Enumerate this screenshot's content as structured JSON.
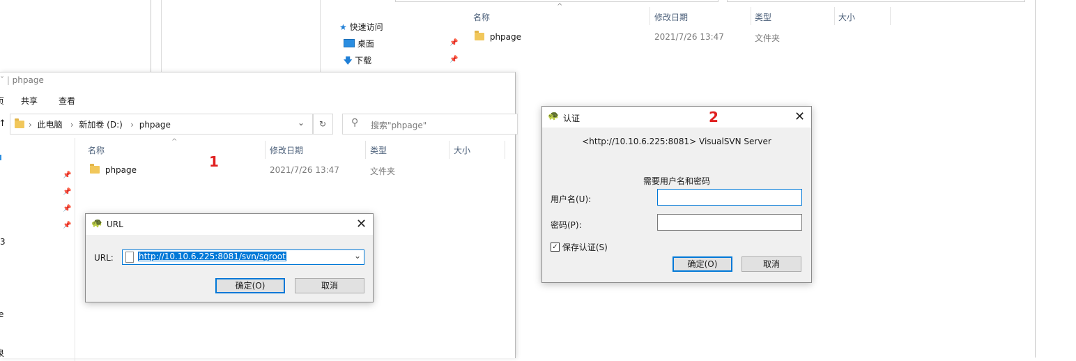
{
  "bg_window": {
    "nav_quick_access": "快速访问",
    "nav_desktop": "桌面",
    "nav_downloads": "下载",
    "columns": [
      "名称",
      "修改日期",
      "类型",
      "大小"
    ],
    "row": {
      "name": "phpage",
      "date": "2021/7/26 13:47",
      "type": "文件夹"
    }
  },
  "fg_window": {
    "title": "phpage",
    "ribbon_partial": "页",
    "ribbon_share": "共享",
    "ribbon_view": "查看",
    "breadcrumb": [
      "此电脑",
      "新加卷 (D:)",
      "phpage"
    ],
    "search_placeholder": "搜索\"phpage\"",
    "columns": [
      "名称",
      "修改日期",
      "类型",
      "大小"
    ],
    "row": {
      "name": "phpage",
      "date": "2021/7/26 13:47",
      "type": "文件夹"
    },
    "sidebar_partial": [
      "3",
      "e",
      "泉"
    ]
  },
  "url_dialog": {
    "title": "URL",
    "label": "URL:",
    "value": "http://10.10.6.225:8081/svn/sgroot",
    "ok": "确定(O)",
    "cancel": "取消"
  },
  "auth_dialog": {
    "title": "认证",
    "server": "<http://10.10.6.225:8081> VisualSVN Server",
    "prompt": "需要用户名和密码",
    "username_label": "用户名(U):",
    "password_label": "密码(P):",
    "save_label": "保存认证(S)",
    "ok": "确定(O)",
    "cancel": "取消"
  },
  "annotations": {
    "mark1": "1",
    "mark2": "2"
  },
  "colors": {
    "accent": "#0078d7",
    "annotation": "#e02020",
    "folder": "#f1c75b"
  }
}
